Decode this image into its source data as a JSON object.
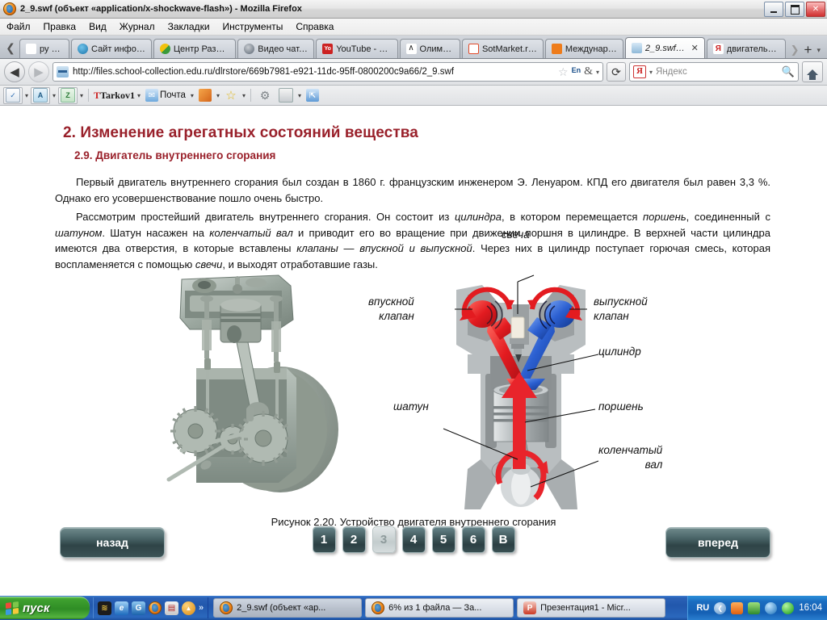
{
  "window": {
    "title": "2_9.swf (объект «application/x-shockwave-flash») - Mozilla Firefox",
    "minimize_label": "",
    "maximize_label": "",
    "close_label": "✕"
  },
  "menu": {
    "items": [
      {
        "label": "Файл"
      },
      {
        "label": "Правка"
      },
      {
        "label": "Вид"
      },
      {
        "label": "Журнал"
      },
      {
        "label": "Закладки"
      },
      {
        "label": "Инструменты"
      },
      {
        "label": "Справка"
      }
    ]
  },
  "tabs": {
    "scroll_left_label": "❮",
    "scroll_right_label": "❯",
    "new_tab_label": "+",
    "list_all_label": "▾",
    "items": [
      {
        "label": "ру С...",
        "favicon_color": "#ffffff",
        "favicon_text": "",
        "active": false
      },
      {
        "label": "Сайт инфор...",
        "favicon_color": "#2e9fd4",
        "favicon_text": "",
        "active": false
      },
      {
        "label": "Центр Разви...",
        "favicon_color": "#f2c20c",
        "favicon_text": "",
        "active": false
      },
      {
        "label": "Видео чат, ...",
        "favicon_color": "#7d8894",
        "favicon_text": "",
        "active": false
      },
      {
        "label": "YouTube - Br...",
        "favicon_color": "#cc2222",
        "favicon_text": "Yo",
        "active": false
      },
      {
        "label": "Олимпус",
        "favicon_color": "#ffffff",
        "favicon_text": "∧",
        "active": false
      },
      {
        "label": "SotMarket.ru...",
        "favicon_color": "#ffffff",
        "favicon_text": "",
        "active": false
      },
      {
        "label": "Междунаро...",
        "favicon_color": "#ee7c1b",
        "favicon_text": "",
        "active": false
      },
      {
        "label": "2_9.swf (...",
        "favicon_color": "#9ec4e2",
        "favicon_text": "",
        "active": true,
        "close_label": "✕"
      },
      {
        "label": "двигатель в...",
        "favicon_color": "#ffffff",
        "favicon_text": "Я",
        "active": false
      }
    ]
  },
  "toolbar": {
    "back_label": "◀",
    "forward_label": "▶",
    "reload_label": "⟳",
    "home_label": "",
    "url": "http://files.school-collection.edu.ru/dlrstore/669b7981-e921-11dc-95ff-0800200c9a66/2_9.swf",
    "bookmark_star_label": "☆",
    "language_badge": "En",
    "translate_label": "&",
    "dropdown_label": "▾",
    "search_placeholder": "Яндекс",
    "search_engine": "Я",
    "search_icon": "search-icon"
  },
  "addonbar": {
    "items": [
      {
        "name": "spellcheck-button",
        "glyph": "✓",
        "color": "#2f6fb5",
        "dropdown": true,
        "framed": true
      },
      {
        "name": "dictionary-button",
        "glyph": "A",
        "color": "#3d8fbf",
        "dropdown": true,
        "framed": true
      },
      {
        "name": "translate-button",
        "glyph": "Z",
        "color": "#3a8f4a",
        "dropdown": true,
        "framed": true
      },
      {
        "name": "profile-label",
        "text": "Tarkov1",
        "dropdown": true,
        "framed": false
      },
      {
        "name": "mail-button",
        "glyph": "✉",
        "text": "Почта",
        "color": "#2f6fb5",
        "dropdown": true,
        "framed": false
      },
      {
        "name": "notes-button",
        "glyph": "",
        "color": "#e07b25",
        "dropdown": true,
        "framed": false
      },
      {
        "name": "favorites-button",
        "glyph": "☆",
        "color": "#e8c020",
        "dropdown": true,
        "framed": false
      },
      {
        "name": "settings-gear-button",
        "glyph": "⚙",
        "color": "#8a8f94",
        "dropdown": false,
        "framed": false
      },
      {
        "name": "disk-button",
        "glyph": "▭",
        "color": "#9aa0a6",
        "dropdown": true,
        "framed": false
      },
      {
        "name": "share-button",
        "glyph": "⇱",
        "color": "#3f7fc4",
        "dropdown": false,
        "framed": false
      }
    ]
  },
  "page": {
    "heading": "2. Изменение агрегатных состояний вещества",
    "subheading": "2.9. Двигатель внутреннего сгорания",
    "paragraph1_html": "Первый двигатель внутреннего сгорания был создан в 1860 г. французским инженером Э. Ленуаром. КПД его двигателя был равен 3,3 %. Однако его усовершенствование пошло очень быстро.",
    "paragraph2_parts": [
      {
        "text": "Рассмотрим простейший двигатель внутреннего сгорания. Он состоит из ",
        "italic": false
      },
      {
        "text": "цилиндра",
        "italic": true
      },
      {
        "text": ", в котором перемещается ",
        "italic": false
      },
      {
        "text": "поршень",
        "italic": true
      },
      {
        "text": ", соединенный с ",
        "italic": false
      },
      {
        "text": "шатуном",
        "italic": true
      },
      {
        "text": ". Шатун насажен на ",
        "italic": false
      },
      {
        "text": "коленчатый вал",
        "italic": true
      },
      {
        "text": " и приводит его во вращение при движении поршня в цилиндре. В верхней части цилиндра имеются два отверстия, в которые вставлены ",
        "italic": false
      },
      {
        "text": "клапаны — впускной и выпускной",
        "italic": true
      },
      {
        "text": ". Через них в цилиндр поступает горючая смесь, которая воспламеняется с помощью ",
        "italic": false
      },
      {
        "text": "свечи",
        "italic": true
      },
      {
        "text": ", и выходят отработавшие газы.",
        "italic": false
      }
    ],
    "figure_caption": "Рисунок 2.20. Устройство двигателя внутреннего сгорания",
    "diagram_labels": {
      "spark_plug": "свеча",
      "intake_valve": "впускной\nклапан",
      "intake_valve_line1": "впускной",
      "intake_valve_line2": "клапан",
      "exhaust_valve_line1": "выпускной",
      "exhaust_valve_line2": "клапан",
      "cylinder": "цилиндр",
      "connecting_rod": "шатун",
      "piston": "поршень",
      "crankshaft_line1": "коленчатый",
      "crankshaft_line2": "вал"
    },
    "buttons": {
      "back": "назад",
      "forward": "вперед"
    },
    "pager": {
      "items": [
        "1",
        "2",
        "3",
        "4",
        "5",
        "6",
        "В"
      ],
      "current": "3"
    },
    "colors": {
      "heading": "#99202a",
      "button": "#3c5356",
      "intake_red": "#e8242b",
      "exhaust_blue": "#2b5fd0"
    }
  },
  "taskbar": {
    "start_label": "пуск",
    "quicklaunch": [
      {
        "name": "quicklaunch-console",
        "color": "#1c1c1c",
        "glyph": "≋"
      },
      {
        "name": "quicklaunch-internet-explorer",
        "color": "#1d74c4",
        "glyph": "e"
      },
      {
        "name": "quicklaunch-app-blue",
        "color": "#2f7fd0",
        "glyph": "G"
      },
      {
        "name": "quicklaunch-firefox",
        "color": "#e8741c",
        "glyph": ""
      },
      {
        "name": "quicklaunch-save",
        "color": "#d8d8d8",
        "glyph": "▤"
      },
      {
        "name": "quicklaunch-orange-circle",
        "color": "#e8a21c",
        "glyph": "▲"
      }
    ],
    "overflow_label": "»",
    "items": [
      {
        "label": "2_9.swf (объект «ар...",
        "active": true,
        "icon": "firefox-icon"
      },
      {
        "label": "6% из 1 файла — За...",
        "active": false,
        "icon": "firefox-icon"
      },
      {
        "label": "Презентация1 - Micr...",
        "active": false,
        "icon": "powerpoint-icon",
        "icon_color": "#cc3b25",
        "icon_glyph": "P"
      }
    ],
    "tray": {
      "language": "RU",
      "icons": [
        {
          "name": "tray-hide-arrow",
          "color": "#8fb9e0",
          "glyph": "❮"
        },
        {
          "name": "tray-app-orange",
          "color": "#e8661c",
          "glyph": ""
        },
        {
          "name": "tray-network",
          "color": "#3f8f3f",
          "glyph": ""
        },
        {
          "name": "tray-volume",
          "color": "#2f8fd0",
          "glyph": ""
        },
        {
          "name": "tray-shield-green",
          "color": "#1fa81f",
          "glyph": ""
        }
      ],
      "clock": "16:04"
    }
  }
}
